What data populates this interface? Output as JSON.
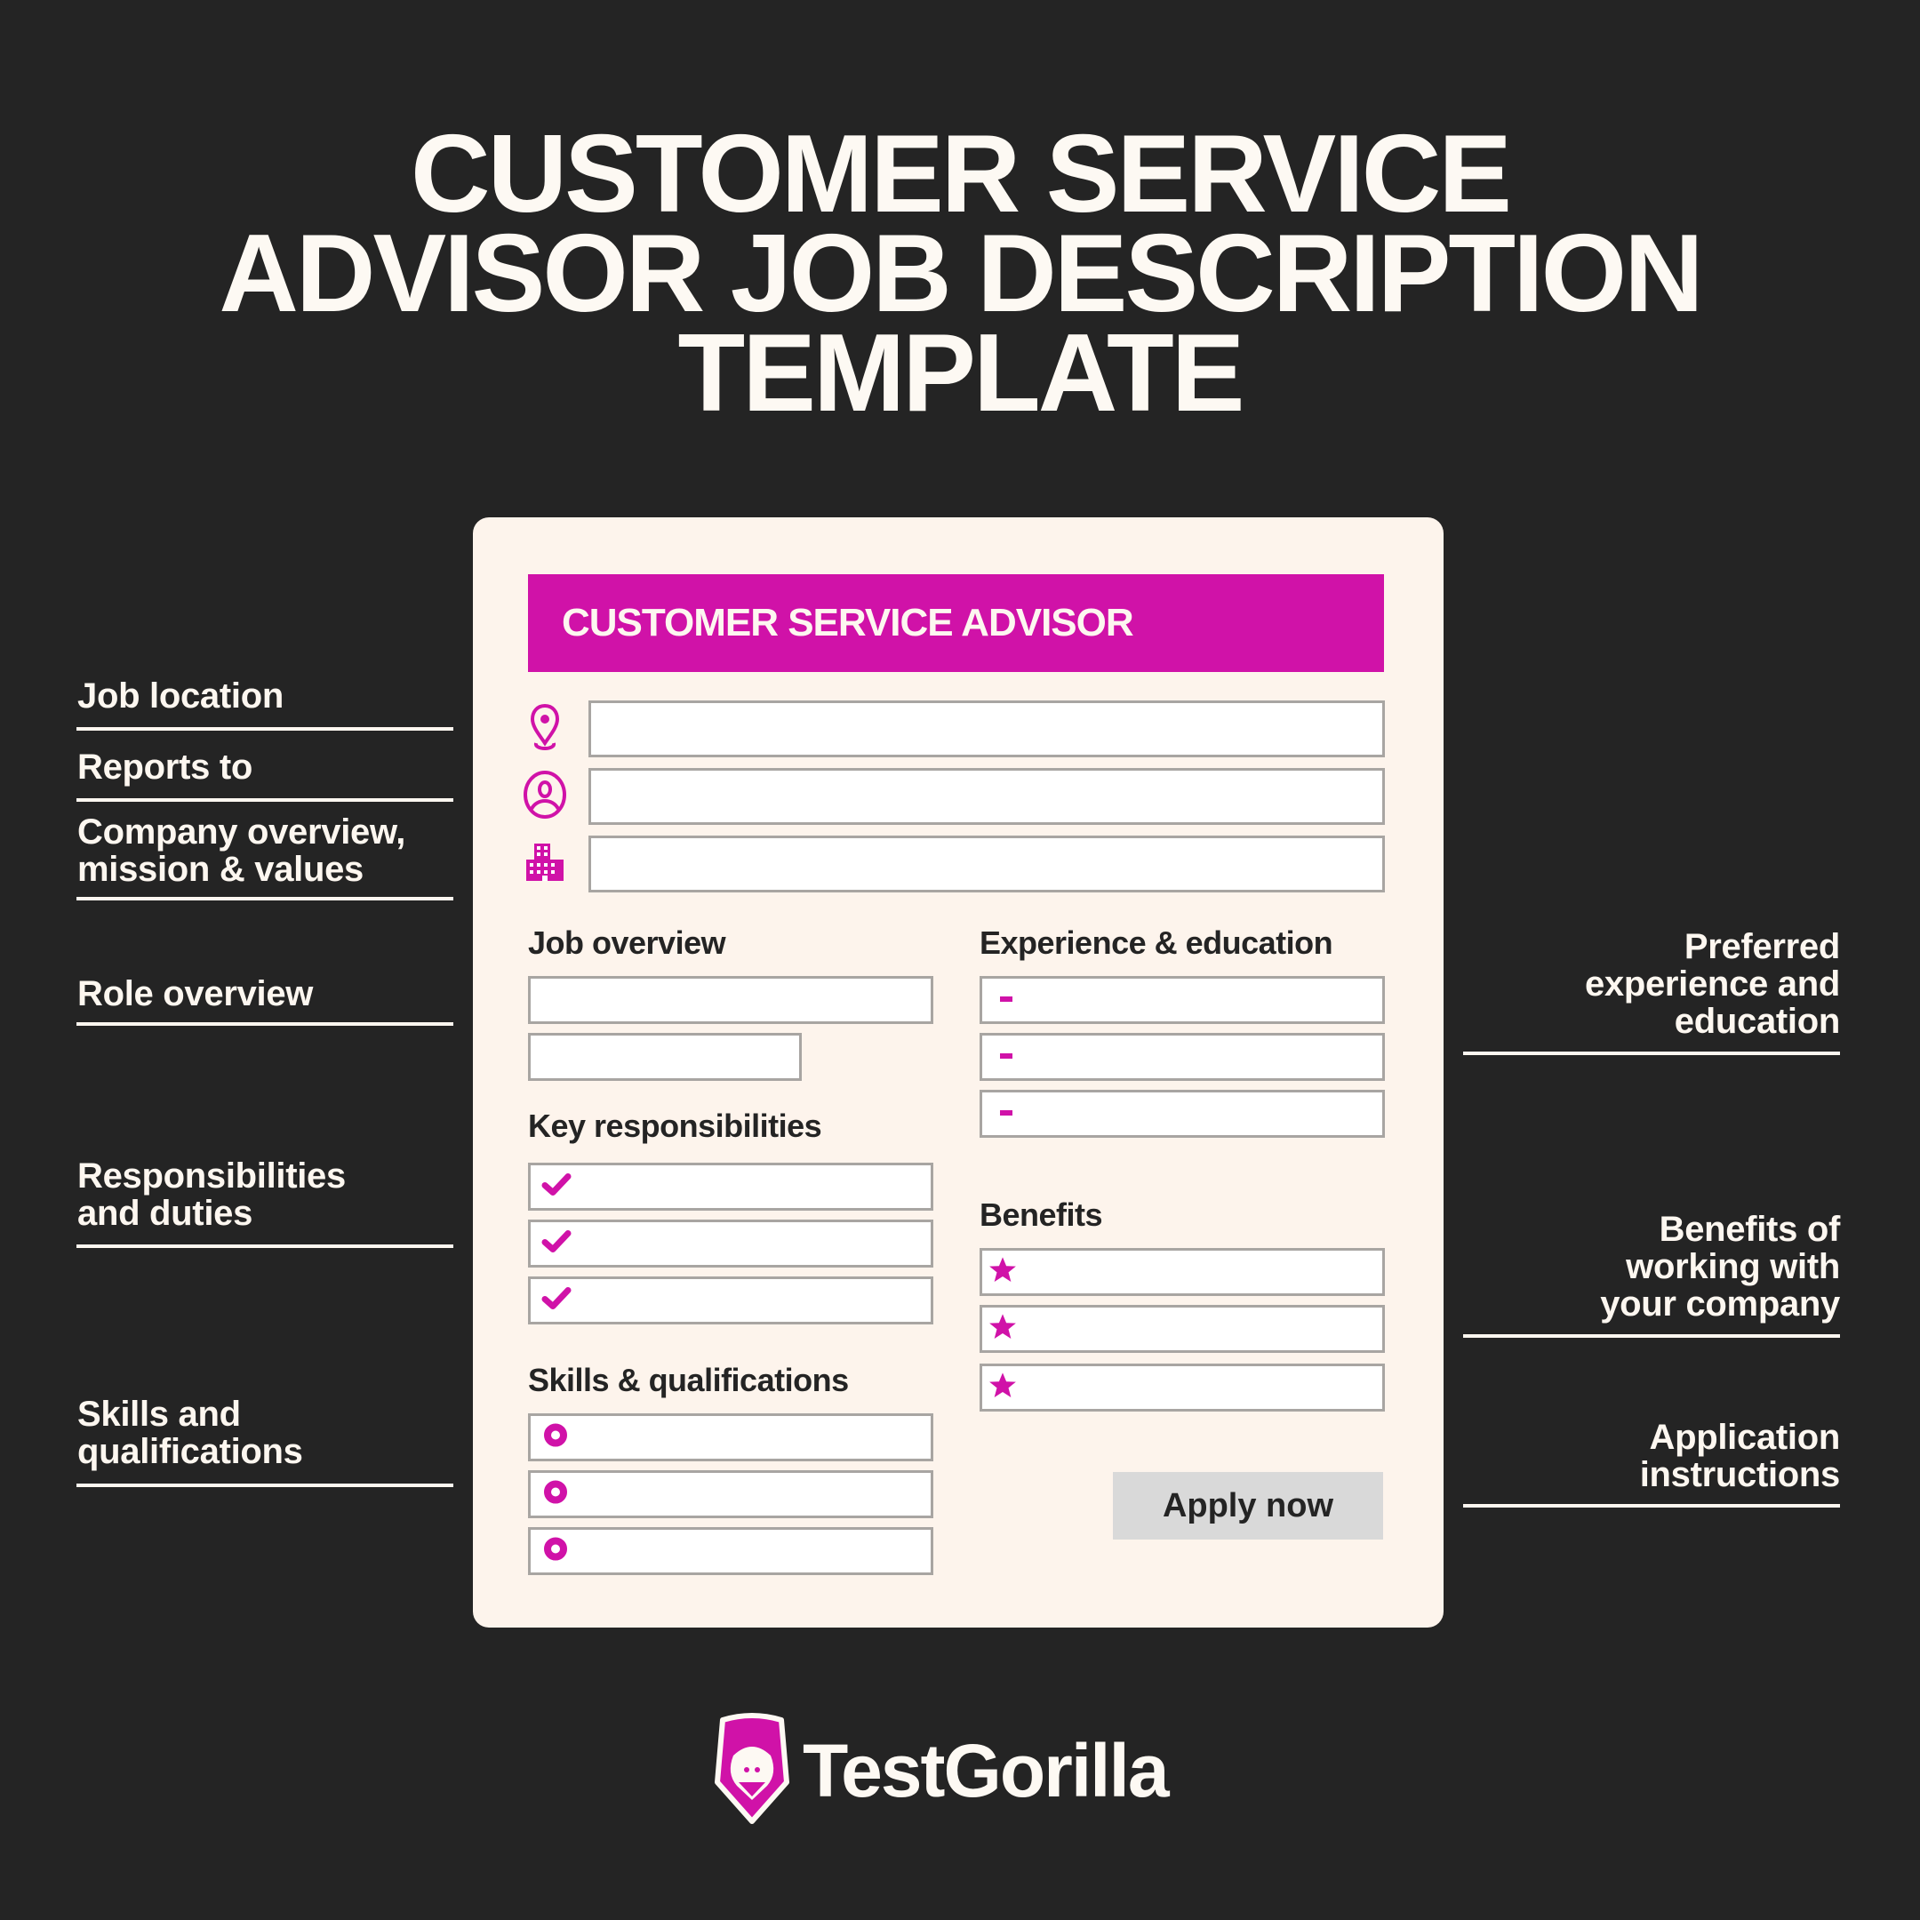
{
  "title": {
    "lines": [
      "CUSTOMER SERVICE",
      "ADVISOR JOB DESCRIPTION",
      "TEMPLATE"
    ]
  },
  "left_labels": [
    {
      "lines": [
        "Job location"
      ]
    },
    {
      "lines": [
        "Reports to"
      ]
    },
    {
      "lines": [
        "Company overview,",
        "mission & values"
      ]
    },
    {
      "lines": [
        "Role overview"
      ]
    },
    {
      "lines": [
        "Responsibilities",
        "and duties"
      ]
    },
    {
      "lines": [
        "Skills and",
        "qualifications"
      ]
    }
  ],
  "right_labels": [
    {
      "lines": [
        "Preferred",
        "experience and",
        "education"
      ]
    },
    {
      "lines": [
        "Benefits of",
        "working with",
        "your company"
      ]
    },
    {
      "lines": [
        "Application",
        "instructions"
      ]
    }
  ],
  "card": {
    "job_title": "CUSTOMER SERVICE ADVISOR",
    "header_fields": [
      {
        "icon": "location-pin-icon",
        "value": ""
      },
      {
        "icon": "user-circle-icon",
        "value": ""
      },
      {
        "icon": "building-icon",
        "value": ""
      }
    ],
    "job_overview": {
      "heading": "Job overview"
    },
    "key_responsibilities": {
      "heading": "Key responsibilities",
      "bullet": "check-icon"
    },
    "skills": {
      "heading": "Skills & qualifications",
      "bullet": "ring-icon"
    },
    "experience": {
      "heading": "Experience & education",
      "bullet": "dash-icon"
    },
    "benefits": {
      "heading": "Benefits",
      "bullet": "star-icon"
    },
    "apply_label": "Apply now"
  },
  "brand": {
    "name": "TestGorilla",
    "accent": "#d012a8",
    "background": "#242424",
    "card_bg": "#fdf4ec"
  }
}
